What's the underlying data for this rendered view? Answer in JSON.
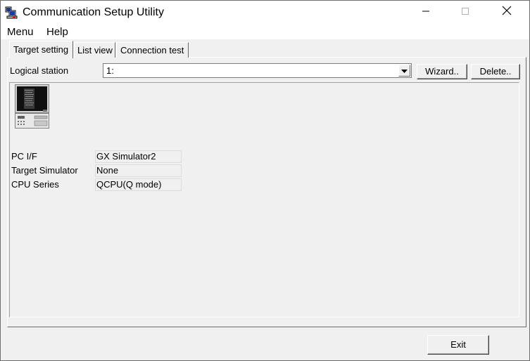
{
  "window": {
    "title": "Communication Setup Utility"
  },
  "titlebar": {
    "minimize_icon": "minimize-icon",
    "maximize_icon": "maximize-icon",
    "close_icon": "close-icon"
  },
  "menubar": {
    "items": [
      {
        "label": "Menu"
      },
      {
        "label": "Help"
      }
    ]
  },
  "tabs": [
    {
      "label": "Target setting",
      "active": true
    },
    {
      "label": "List view",
      "active": false
    },
    {
      "label": "Connection test",
      "active": false
    }
  ],
  "logical_station": {
    "label": "Logical station",
    "value": "1:"
  },
  "buttons": {
    "wizard": "Wizard..",
    "delete": "Delete..",
    "exit": "Exit"
  },
  "target": {
    "icon": "plc-computer-icon",
    "fields": [
      {
        "label": "PC I/F",
        "value": "GX Simulator2"
      },
      {
        "label": "Target Simulator",
        "value": "None"
      },
      {
        "label": "CPU Series",
        "value": "QCPU(Q mode)"
      }
    ]
  }
}
